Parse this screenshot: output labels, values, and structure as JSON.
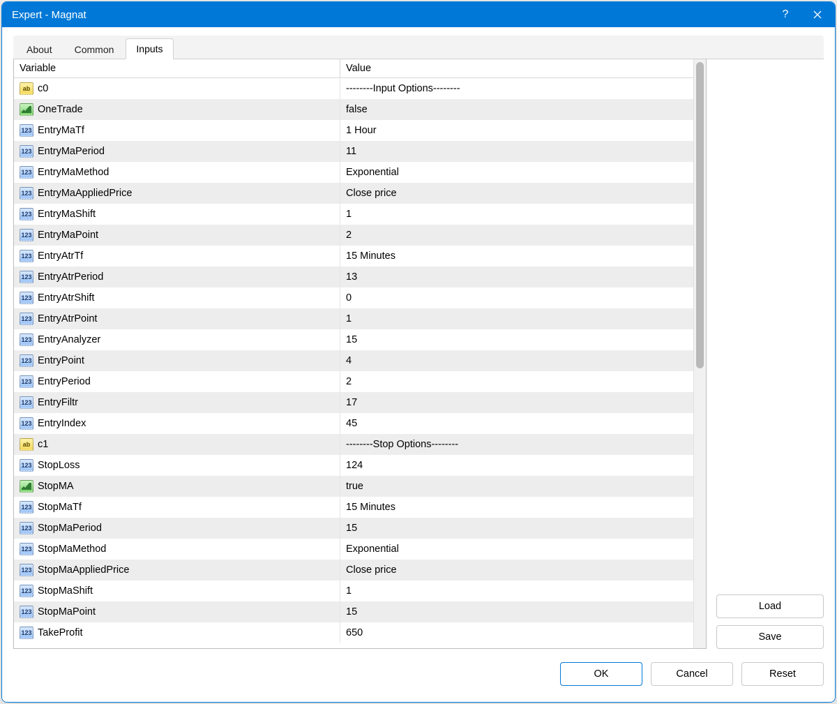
{
  "window": {
    "title": "Expert - Magnat"
  },
  "tabs": [
    {
      "label": "About",
      "active": false
    },
    {
      "label": "Common",
      "active": false
    },
    {
      "label": "Inputs",
      "active": true
    }
  ],
  "columns": {
    "variable": "Variable",
    "value": "Value"
  },
  "rows": [
    {
      "type": "ab",
      "name": "c0",
      "value": "--------Input Options--------"
    },
    {
      "type": "bool",
      "name": "OneTrade",
      "value": "false"
    },
    {
      "type": "int",
      "name": "EntryMaTf",
      "value": "1 Hour"
    },
    {
      "type": "int",
      "name": "EntryMaPeriod",
      "value": "11"
    },
    {
      "type": "int",
      "name": "EntryMaMethod",
      "value": "Exponential"
    },
    {
      "type": "int",
      "name": "EntryMaAppliedPrice",
      "value": "Close price"
    },
    {
      "type": "int",
      "name": "EntryMaShift",
      "value": "1"
    },
    {
      "type": "int",
      "name": "EntryMaPoint",
      "value": "2"
    },
    {
      "type": "int",
      "name": "EntryAtrTf",
      "value": "15 Minutes"
    },
    {
      "type": "int",
      "name": "EntryAtrPeriod",
      "value": "13"
    },
    {
      "type": "int",
      "name": "EntryAtrShift",
      "value": "0"
    },
    {
      "type": "int",
      "name": "EntryAtrPoint",
      "value": "1"
    },
    {
      "type": "int",
      "name": "EntryAnalyzer",
      "value": "15"
    },
    {
      "type": "int",
      "name": "EntryPoint",
      "value": "4"
    },
    {
      "type": "int",
      "name": "EntryPeriod",
      "value": "2"
    },
    {
      "type": "int",
      "name": "EntryFiltr",
      "value": "17"
    },
    {
      "type": "int",
      "name": "EntryIndex",
      "value": "45"
    },
    {
      "type": "ab",
      "name": "c1",
      "value": "--------Stop Options--------"
    },
    {
      "type": "int",
      "name": "StopLoss",
      "value": "124"
    },
    {
      "type": "bool",
      "name": "StopMA",
      "value": "true"
    },
    {
      "type": "int",
      "name": "StopMaTf",
      "value": "15 Minutes"
    },
    {
      "type": "int",
      "name": "StopMaPeriod",
      "value": "15"
    },
    {
      "type": "int",
      "name": "StopMaMethod",
      "value": "Exponential"
    },
    {
      "type": "int",
      "name": "StopMaAppliedPrice",
      "value": "Close price"
    },
    {
      "type": "int",
      "name": "StopMaShift",
      "value": "1"
    },
    {
      "type": "int",
      "name": "StopMaPoint",
      "value": "15"
    },
    {
      "type": "int",
      "name": "TakeProfit",
      "value": "650"
    }
  ],
  "icon_label": {
    "ab": "ab",
    "bool": "",
    "int": "123"
  },
  "side_buttons": {
    "load": "Load",
    "save": "Save"
  },
  "footer_buttons": {
    "ok": "OK",
    "cancel": "Cancel",
    "reset": "Reset"
  }
}
